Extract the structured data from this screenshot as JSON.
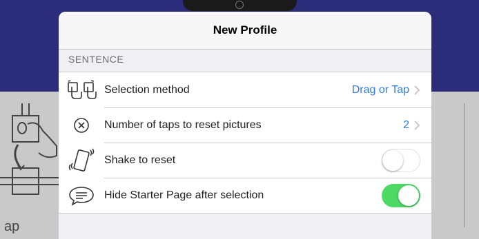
{
  "background": {
    "caption": "ap",
    "colors": {
      "top": "#2b2d7a",
      "bottom": "#c9c9c9"
    }
  },
  "modal": {
    "title": "New Profile",
    "section_header": "SENTENCE",
    "rows": [
      {
        "label": "Selection method",
        "value": "Drag or Tap",
        "icon": "drag-tap-icon",
        "control": "disclosure"
      },
      {
        "label": "Number of taps to reset pictures",
        "value": "2",
        "icon": "close-circle-icon",
        "control": "disclosure"
      },
      {
        "label": "Shake to reset",
        "icon": "shake-phone-icon",
        "control": "switch",
        "on": false
      },
      {
        "label": "Hide Starter Page after selection",
        "icon": "speech-bubble-icon",
        "control": "switch",
        "on": true
      }
    ]
  },
  "colors": {
    "accent": "#2f7be6",
    "switch_on": "#4cd964"
  }
}
